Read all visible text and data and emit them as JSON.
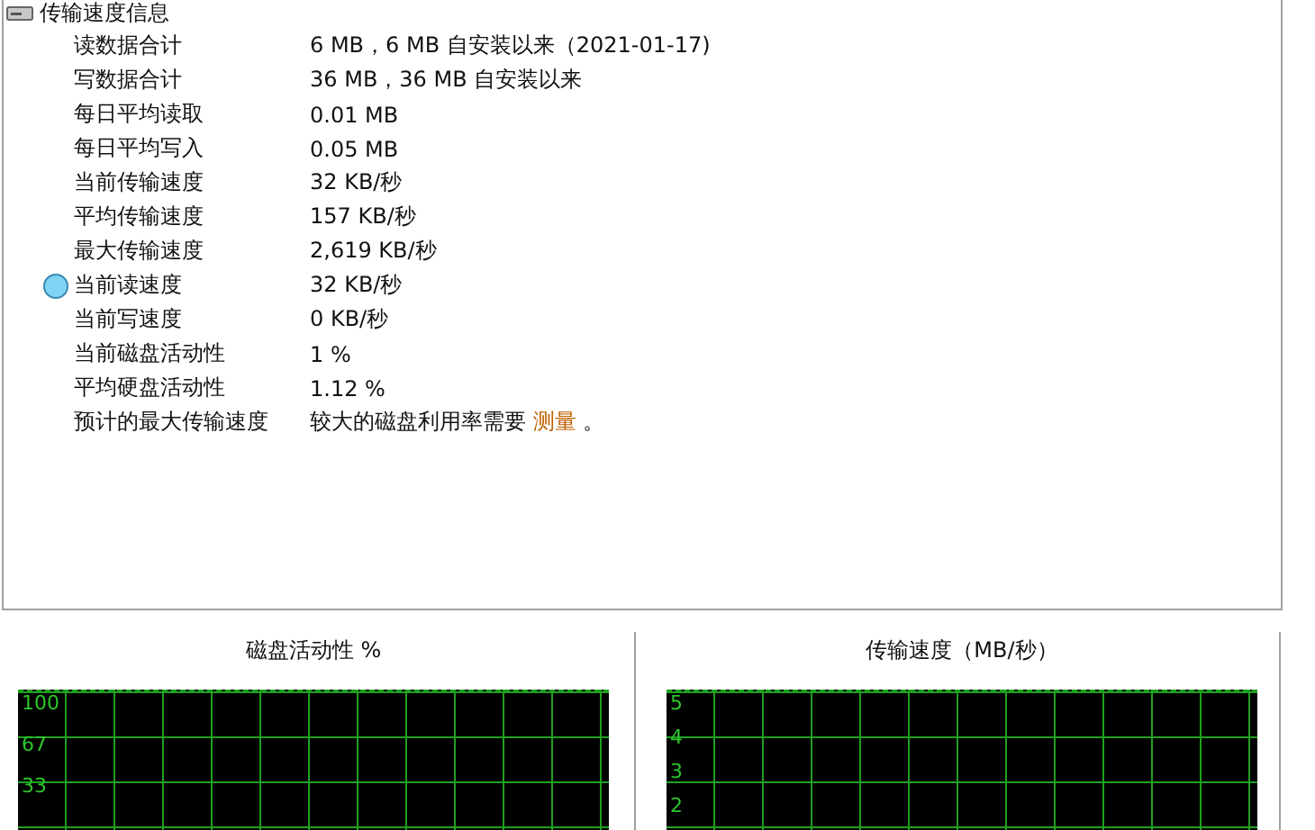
{
  "section": {
    "title": "传输速度信息"
  },
  "rows": [
    {
      "label": "读数据合计",
      "value": "6 MB，6 MB 自安装以来（2021-01-17)"
    },
    {
      "label": "写数据合计",
      "value": "36 MB，36 MB 自安装以来"
    },
    {
      "label": "每日平均读取",
      "value": "0.01 MB"
    },
    {
      "label": "每日平均写入",
      "value": "0.05 MB"
    },
    {
      "label": "当前传输速度",
      "value": "32 KB/秒"
    },
    {
      "label": "平均传输速度",
      "value": "157 KB/秒"
    },
    {
      "label": "最大传输速度",
      "value": "2,619 KB/秒"
    },
    {
      "label": "当前读速度",
      "value": "32 KB/秒",
      "color": "#7fd3f5"
    },
    {
      "label": "当前写速度",
      "value": "0 KB/秒"
    },
    {
      "label": "当前磁盘活动性",
      "value": "1 %"
    },
    {
      "label": "平均硬盘活动性",
      "value": "1.12 %"
    },
    {
      "label": "预计的最大传输速度",
      "value": "较大的磁盘利用率需要",
      "link": "测量",
      "suffix": "。"
    }
  ],
  "graphs": [
    {
      "title": "磁盘活动性 %",
      "axis_labels": [
        "100",
        "67",
        "33"
      ]
    },
    {
      "title": "传输速度（MB/秒）",
      "axis_labels": [
        "5",
        "4",
        "3",
        "2"
      ]
    }
  ]
}
